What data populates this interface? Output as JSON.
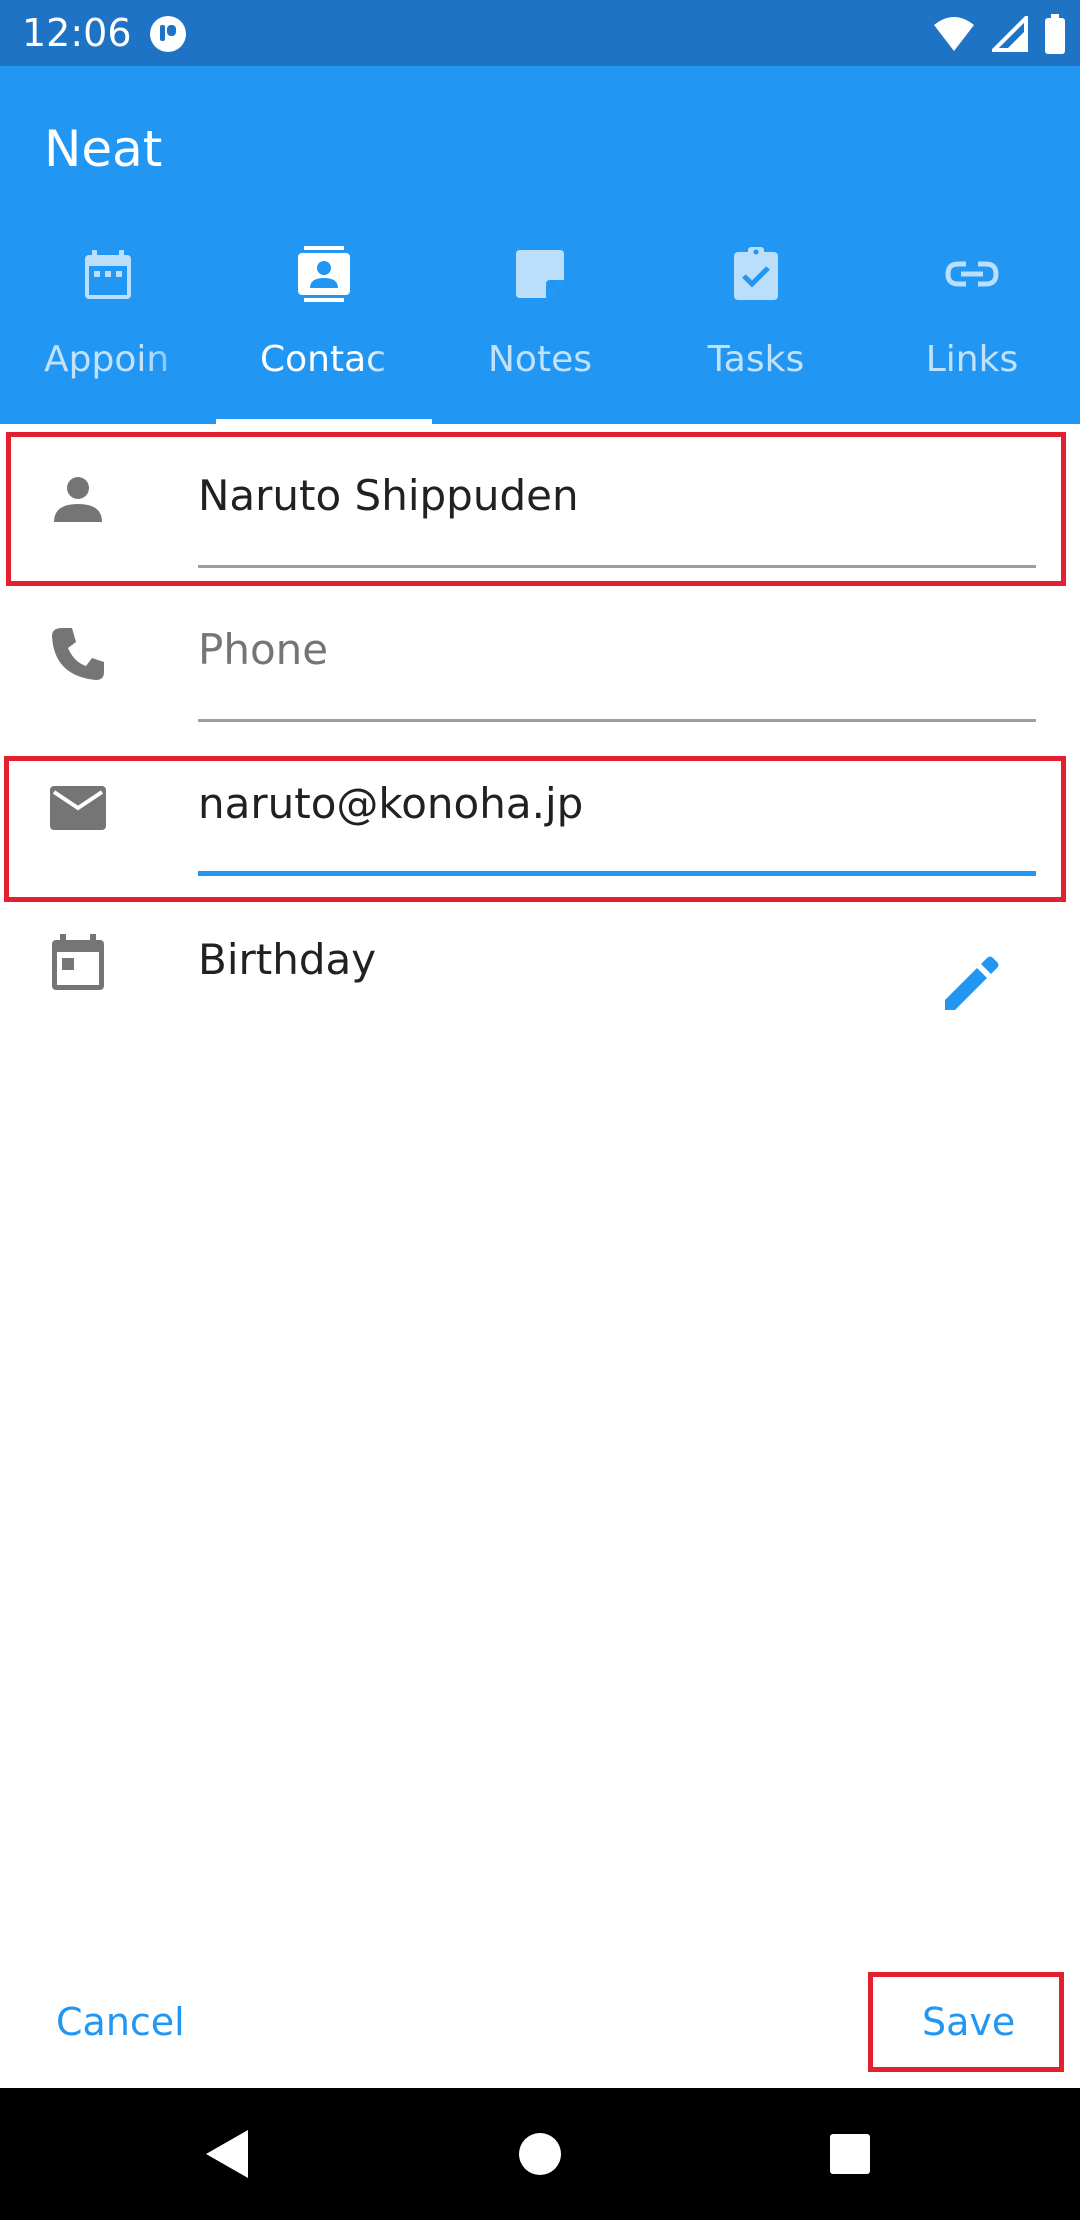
{
  "status_bar": {
    "time": "12:06"
  },
  "app": {
    "title": "Neat"
  },
  "tabs": [
    {
      "label": "Appoin",
      "icon": "calendar-icon",
      "active": false
    },
    {
      "label": "Contac",
      "icon": "contact-card-icon",
      "active": true
    },
    {
      "label": "Notes",
      "icon": "note-icon",
      "active": false
    },
    {
      "label": "Tasks",
      "icon": "clipboard-check-icon",
      "active": false
    },
    {
      "label": "Links",
      "icon": "link-icon",
      "active": false
    }
  ],
  "form": {
    "name_value": "Naruto Shippuden",
    "phone_placeholder": "Phone",
    "email_value": "naruto@konoha.jp",
    "birthday_label": "Birthday"
  },
  "actions": {
    "cancel_label": "Cancel",
    "save_label": "Save"
  },
  "colors": {
    "primary": "#2196f3",
    "status_bar": "#1e73c4",
    "highlight": "#e2202f"
  }
}
